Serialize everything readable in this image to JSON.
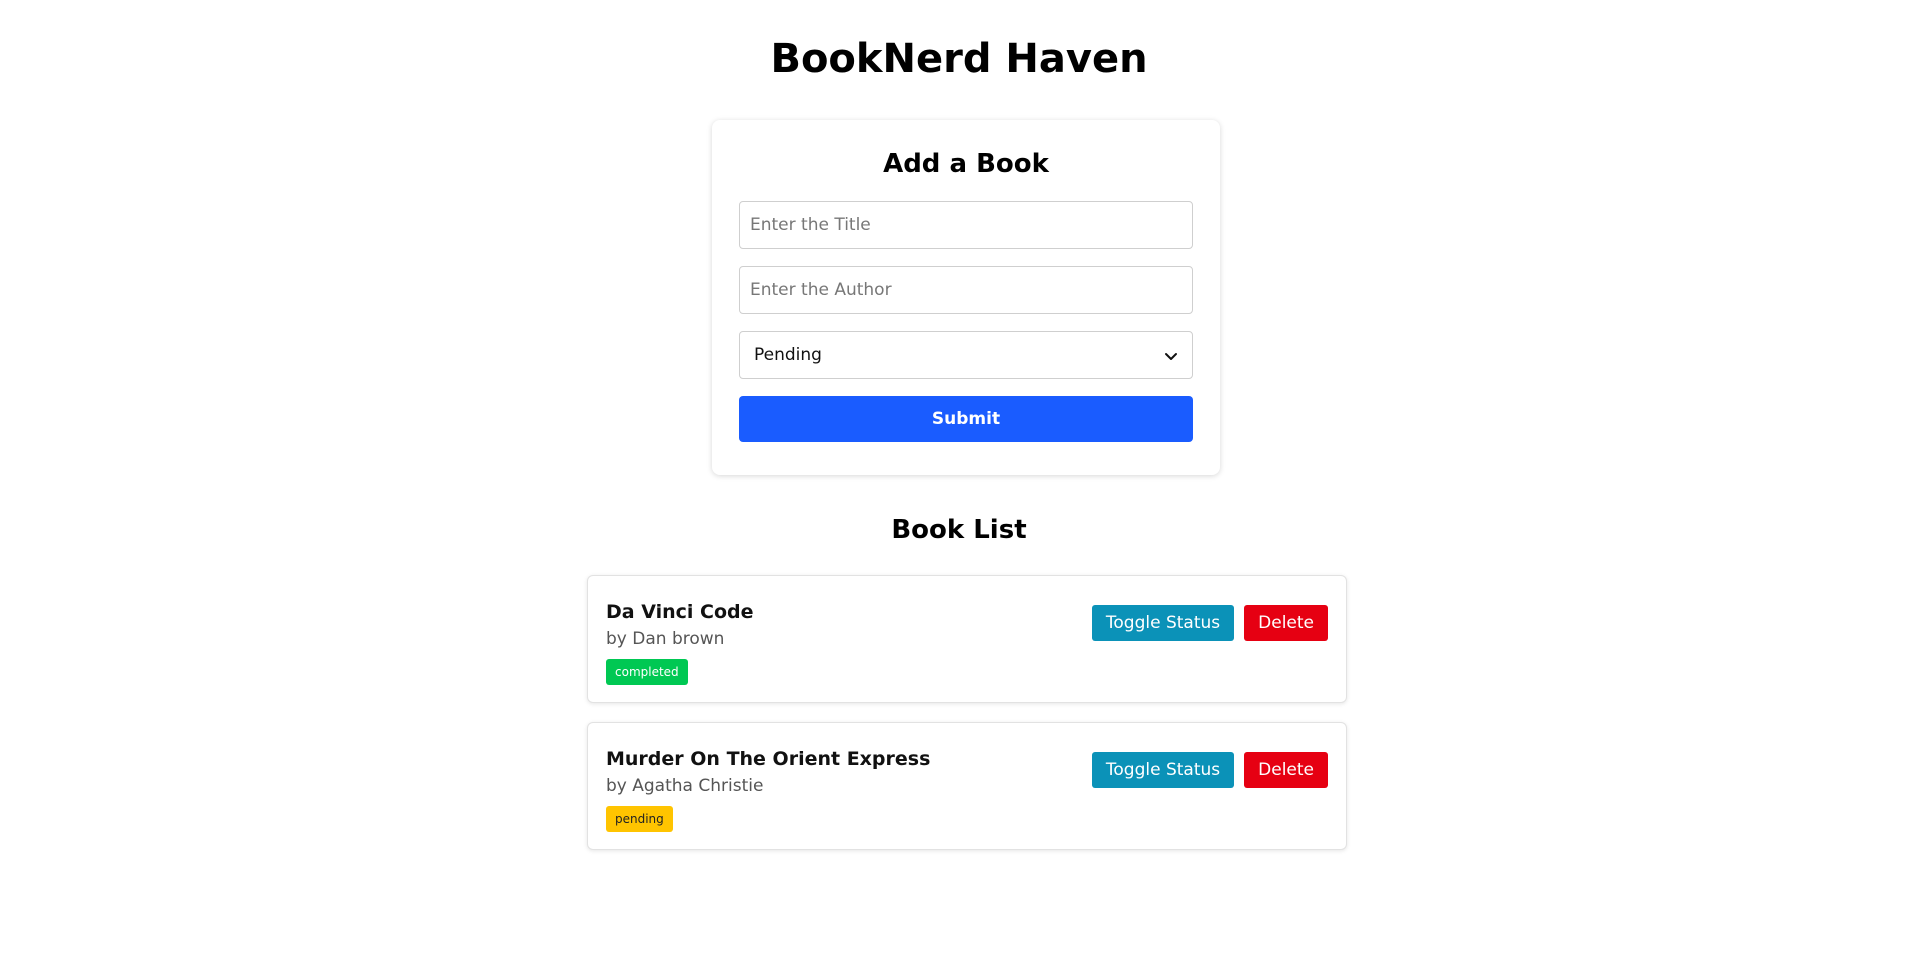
{
  "app": {
    "title": "BookNerd Haven"
  },
  "form": {
    "title": "Add a Book",
    "title_placeholder": "Enter the Title",
    "title_value": "",
    "author_placeholder": "Enter the Author",
    "author_value": "",
    "status_selected": "Pending",
    "submit_label": "Submit"
  },
  "list": {
    "title": "Book List",
    "books": [
      {
        "title": "Da Vinci Code",
        "author": "by Dan brown",
        "status": "completed",
        "toggle_label": "Toggle Status",
        "delete_label": "Delete"
      },
      {
        "title": "Murder On The Orient Express",
        "author": "by Agatha Christie",
        "status": "pending",
        "toggle_label": "Toggle Status",
        "delete_label": "Delete"
      }
    ]
  },
  "colors": {
    "primary": "#1a5cff",
    "toggle": "#0b92b8",
    "delete": "#e60012",
    "completed": "#00c853",
    "pending": "#ffc400"
  },
  "icons": {
    "select_arrow": "chevron-down-icon"
  }
}
